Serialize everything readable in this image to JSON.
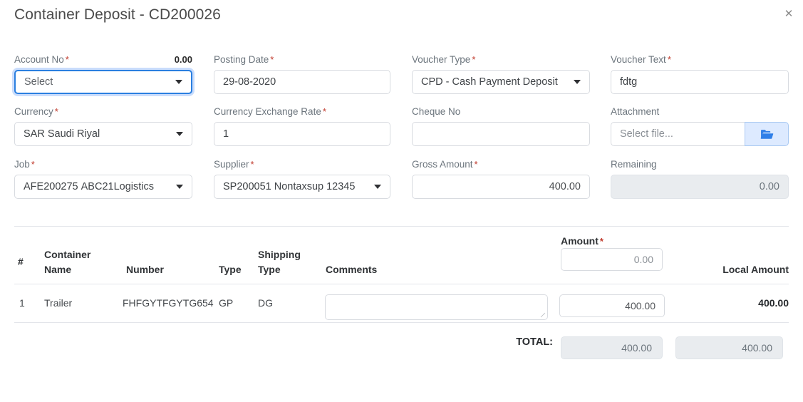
{
  "header": {
    "title": "Container Deposit - CD200026",
    "close_label": "✕"
  },
  "form": {
    "account_no": {
      "label": "Account No",
      "required": "*",
      "right_value": "0.00",
      "value": "Select",
      "is_placeholder": true
    },
    "posting_date": {
      "label": "Posting Date",
      "required": "*",
      "value": "29-08-2020"
    },
    "voucher_type": {
      "label": "Voucher Type",
      "required": "*",
      "value": "CPD - Cash Payment Deposit"
    },
    "voucher_text": {
      "label": "Voucher Text",
      "required": "*",
      "value": "fdtg"
    },
    "currency": {
      "label": "Currency",
      "required": "*",
      "code": "SAR",
      "name": "Saudi Riyal"
    },
    "currency_exchange_rate": {
      "label": "Currency Exchange Rate",
      "required": "*",
      "value": "1"
    },
    "cheque_no": {
      "label": "Cheque No",
      "required": "",
      "value": ""
    },
    "attachment": {
      "label": "Attachment",
      "required": "",
      "placeholder": "Select file...",
      "button_icon": "folder-open-icon"
    },
    "job": {
      "label": "Job",
      "required": "*",
      "code": "AFE200275",
      "name": "ABC21Logistics"
    },
    "supplier": {
      "label": "Supplier",
      "required": "*",
      "code": "SP200051",
      "name": "Nontaxsup 12345"
    },
    "gross_amount": {
      "label": "Gross Amount",
      "required": "*",
      "value": "400.00"
    },
    "remaining": {
      "label": "Remaining",
      "required": "",
      "value": "0.00"
    }
  },
  "table": {
    "columns": {
      "index": "#",
      "container_name_line1": "Container",
      "container_name_line2": "Name",
      "number": "Number",
      "type": "Type",
      "shipping_type_line1": "Shipping",
      "shipping_type_line2": "Type",
      "comments": "Comments",
      "amount": "Amount",
      "amount_required": "*",
      "local_amount": "Local Amount"
    },
    "amount_header_input_value": "0.00",
    "rows": [
      {
        "index": "1",
        "container_name": "Trailer",
        "number": "FHFGYTFGYTG654",
        "type": "GP",
        "shipping_type": "DG",
        "comments": "",
        "amount": "400.00",
        "local_amount": "400.00"
      }
    ],
    "total": {
      "label": "TOTAL:",
      "amount": "400.00",
      "local_amount": "400.00"
    }
  },
  "colors": {
    "accent": "#2a7fe0",
    "required": "#c0392b",
    "attachment_button_bg": "#ddeaff",
    "readonly_bg": "#e9ecef"
  }
}
